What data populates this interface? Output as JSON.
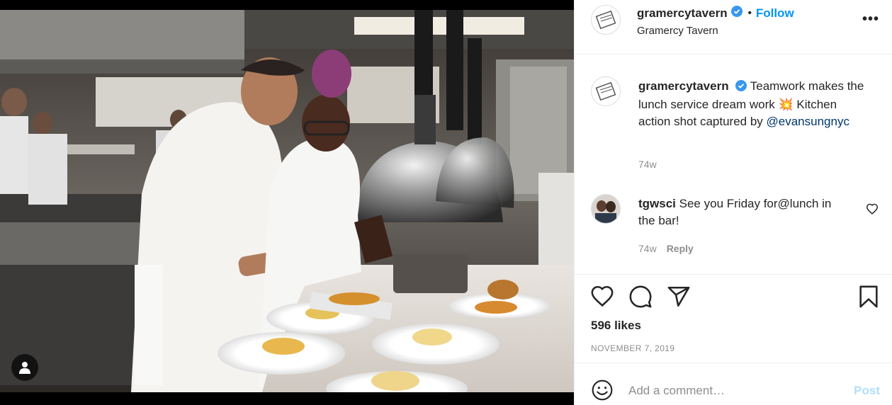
{
  "post": {
    "photo_label": "Kitchen photo",
    "user_tag_icon": "user-icon"
  },
  "header": {
    "username": "gramercytavern",
    "dot": "•",
    "follow_label": "Follow",
    "location": "Gramercy Tavern",
    "more": "•••"
  },
  "caption": {
    "username": "gramercytavern",
    "text": "Teamwork makes the lunch service dream work 💥 Kitchen action shot captured by ",
    "mention": "@evansungnyc",
    "time": "74w"
  },
  "comment": {
    "username": "tgwsci",
    "text": "See you Friday for@lunch in the bar!",
    "time": "74w",
    "reply_label": "Reply"
  },
  "actions": {
    "likes": "596 likes",
    "date": "NOVEMBER 7, 2019"
  },
  "add_comment": {
    "placeholder": "Add a comment…",
    "post_label": "Post"
  },
  "colors": {
    "link": "#0095f6",
    "secondary": "#8e8e8e",
    "post_disabled": "#b2dffc"
  }
}
